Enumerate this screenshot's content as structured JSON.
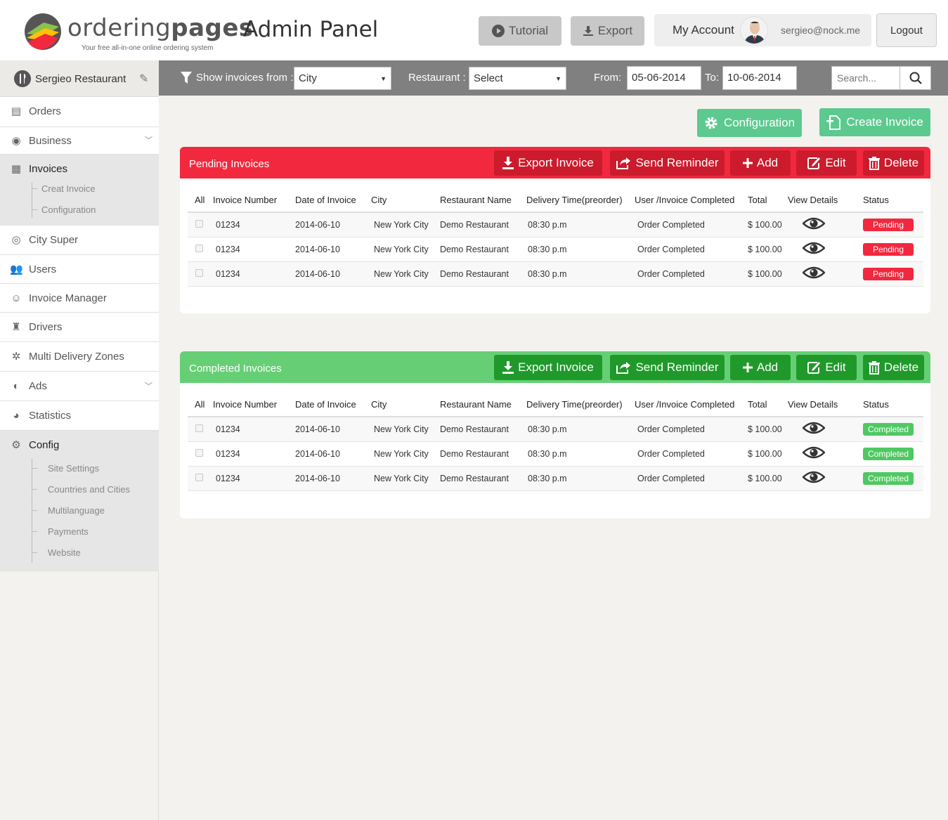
{
  "header": {
    "logo_text_light": "ordering",
    "logo_text_bold": "pages",
    "logo_tagline": "Your free all-in-one online ordering system",
    "app_title": "Admin Panel",
    "tutorial_label": "Tutorial",
    "export_label": "Export",
    "my_account_label": "My Account",
    "account_email": "sergieo@nock.me",
    "logout_label": "Logout"
  },
  "sidebar": {
    "restaurant_name": "Sergieo Restaurant",
    "items": [
      {
        "label": "Orders",
        "icon": "orders-icon"
      },
      {
        "label": "Business",
        "icon": "business-icon"
      },
      {
        "label": "Invoices",
        "icon": "invoices-icon",
        "sub": [
          "Creat Invoice",
          "Configuration"
        ]
      },
      {
        "label": "City Super",
        "icon": "city-super-icon"
      },
      {
        "label": "Users",
        "icon": "users-icon"
      },
      {
        "label": "Invoice Manager",
        "icon": "invoice-manager-icon"
      },
      {
        "label": "Drivers",
        "icon": "drivers-icon"
      },
      {
        "label": "Multi Delivery Zones",
        "icon": "zones-icon"
      },
      {
        "label": "Ads",
        "icon": "ads-icon"
      },
      {
        "label": "Statistics",
        "icon": "statistics-icon"
      },
      {
        "label": "Config",
        "icon": "config-icon",
        "sub": [
          "Site Settings",
          "Countries and Cities",
          "Multilanguage",
          "Payments",
          "Website"
        ]
      }
    ]
  },
  "filters": {
    "show_from_label": "Show invoices from :",
    "show_from_value": "City",
    "restaurant_label": "Restaurant :",
    "restaurant_value": "Select",
    "from_label": "From:",
    "from_value": "05-06-2014",
    "to_label": "To:",
    "to_value": "10-06-2014",
    "search_placeholder": "Search..."
  },
  "actions": {
    "configuration_label": "Configuration",
    "create_invoice_label": "Create Invoice"
  },
  "panel_buttons": {
    "export": "Export Invoice",
    "reminder": "Send Reminder",
    "add": "Add",
    "edit": "Edit",
    "delete": "Delete"
  },
  "columns": [
    "All",
    "Invoice Number",
    "Date of Invoice",
    "City",
    "Restaurant Name",
    "Delivery Time(preorder)",
    "User /Invoice Completed",
    "Total",
    "View Details",
    "Status"
  ],
  "pending": {
    "title": "Pending Invoices",
    "rows": [
      {
        "number": "01234",
        "date": "2014-06-10",
        "city": "New York City",
        "restaurant": "Demo Restaurant",
        "delivery": "08:30 p.m",
        "completed": "Order Completed",
        "total": "$ 100.00",
        "status": "Pending"
      },
      {
        "number": "01234",
        "date": "2014-06-10",
        "city": "New York City",
        "restaurant": "Demo Restaurant",
        "delivery": "08:30 p.m",
        "completed": "Order Completed",
        "total": "$ 100.00",
        "status": "Pending"
      },
      {
        "number": "01234",
        "date": "2014-06-10",
        "city": "New York City",
        "restaurant": "Demo Restaurant",
        "delivery": "08:30 p.m",
        "completed": "Order Completed",
        "total": "$ 100.00",
        "status": "Pending"
      }
    ]
  },
  "completed": {
    "title": "Completed Invoices",
    "rows": [
      {
        "number": "01234",
        "date": "2014-06-10",
        "city": "New York City",
        "restaurant": "Demo Restaurant",
        "delivery": "08:30 p.m",
        "completed": "Order Completed",
        "total": "$ 100.00",
        "status": "Completed"
      },
      {
        "number": "01234",
        "date": "2014-06-10",
        "city": "New York City",
        "restaurant": "Demo Restaurant",
        "delivery": "08:30 p.m",
        "completed": "Order Completed",
        "total": "$ 100.00",
        "status": "Completed"
      },
      {
        "number": "01234",
        "date": "2014-06-10",
        "city": "New York City",
        "restaurant": "Demo Restaurant",
        "delivery": "08:30 p.m",
        "completed": "Order Completed",
        "total": "$ 100.00",
        "status": "Completed"
      }
    ]
  },
  "colors": {
    "pending_header": "#f2283f",
    "completed_header": "#66cf75",
    "action_green": "#5cc98f",
    "filterbar": "#808080"
  }
}
